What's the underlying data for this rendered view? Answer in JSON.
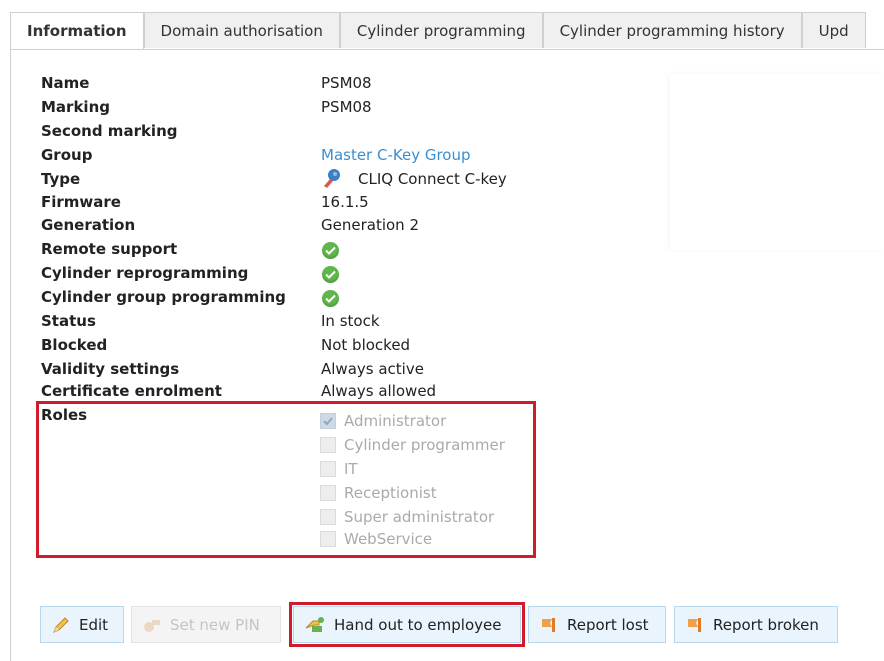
{
  "tabs": [
    {
      "label": "Information",
      "active": true
    },
    {
      "label": "Domain authorisation",
      "active": false
    },
    {
      "label": "Cylinder programming",
      "active": false
    },
    {
      "label": "Cylinder programming history",
      "active": false
    },
    {
      "label": "Upd",
      "active": false
    }
  ],
  "fields": {
    "name": {
      "label": "Name",
      "value": "PSM08"
    },
    "marking": {
      "label": "Marking",
      "value": "PSM08"
    },
    "second_marking": {
      "label": "Second marking",
      "value": ""
    },
    "group": {
      "label": "Group",
      "value": "Master C-Key Group"
    },
    "type": {
      "label": "Type",
      "value": "CLIQ Connect C-key",
      "icon": "key-icon"
    },
    "firmware": {
      "label": "Firmware",
      "value": "16.1.5"
    },
    "generation": {
      "label": "Generation",
      "value": "Generation 2"
    },
    "remote_support": {
      "label": "Remote support",
      "icon": "check-circle-icon"
    },
    "cylinder_reprogramming": {
      "label": "Cylinder reprogramming",
      "icon": "check-circle-icon"
    },
    "cylinder_group_programming": {
      "label": "Cylinder group programming",
      "icon": "check-circle-icon"
    },
    "status": {
      "label": "Status",
      "value": "In stock"
    },
    "blocked": {
      "label": "Blocked",
      "value": "Not blocked"
    },
    "validity_settings": {
      "label": "Validity settings",
      "value": "Always active"
    },
    "certificate_enrolment": {
      "label": "Certificate enrolment",
      "value": "Always allowed"
    }
  },
  "roles": {
    "label": "Roles",
    "items": [
      {
        "label": "Administrator",
        "checked": true
      },
      {
        "label": "Cylinder programmer",
        "checked": false
      },
      {
        "label": "IT",
        "checked": false
      },
      {
        "label": "Receptionist",
        "checked": false
      },
      {
        "label": "Super administrator",
        "checked": false
      },
      {
        "label": "WebService",
        "checked": false
      }
    ]
  },
  "actions": {
    "edit": {
      "label": "Edit",
      "icon": "pencil-icon"
    },
    "set_new_pin": {
      "label": "Set new PIN",
      "icon": "pin-icon",
      "disabled": true
    },
    "hand_out": {
      "label": "Hand out to employee",
      "icon": "hand-out-icon"
    },
    "report_lost": {
      "label": "Report lost",
      "icon": "report-flag-icon"
    },
    "report_broken": {
      "label": "Report broken",
      "icon": "report-flag-icon"
    }
  },
  "colors": {
    "highlight": "#d11a2a",
    "link": "#3a8fd1",
    "check": "#5fb74a",
    "button_bg": "#e9f4fc"
  }
}
